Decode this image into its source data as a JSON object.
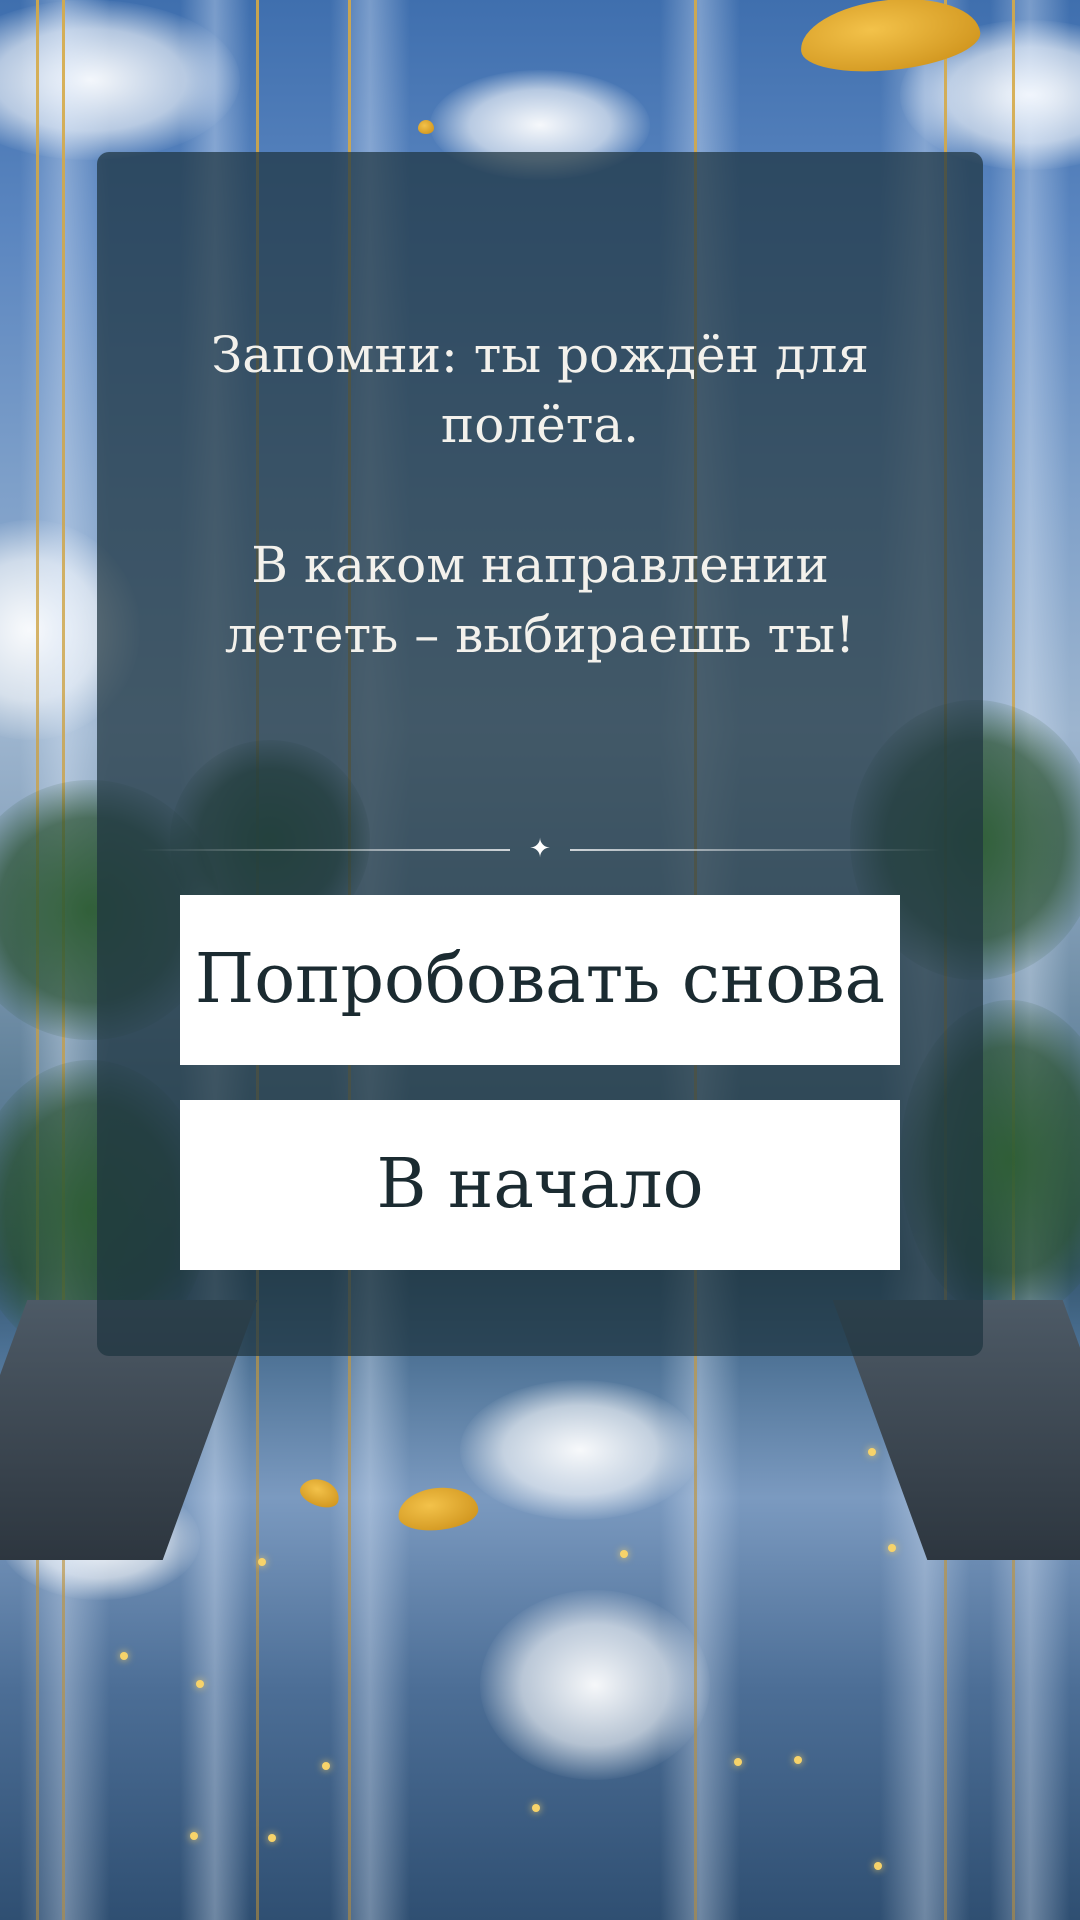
{
  "screen": {
    "message": {
      "line1": "Запомни: ты рождён для полёта.",
      "line2": "В каком направлении лететь – выбираешь ты!"
    },
    "divider_icon": "sparkle-star-icon",
    "buttons": {
      "retry_label": "Попробовать снова",
      "home_label": "В начало"
    }
  },
  "colors": {
    "card_overlay": "#1e3440",
    "button_bg": "#ffffff",
    "button_text": "#1b2b31",
    "message_text": "#f3f1ec",
    "accent_gold": "#d6aa46"
  }
}
